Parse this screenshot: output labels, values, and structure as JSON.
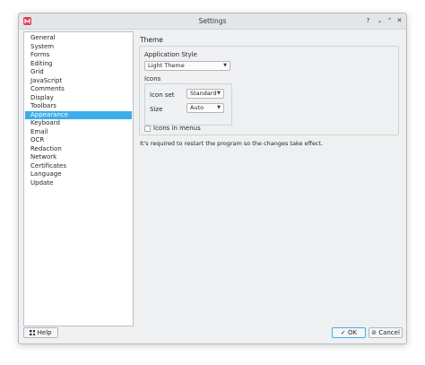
{
  "window": {
    "title": "Settings"
  },
  "titlebar": {
    "help": "?",
    "minimize": "⌄",
    "maximize": "⌃",
    "close": "✕"
  },
  "sidebar": {
    "items": [
      {
        "label": "General"
      },
      {
        "label": "System"
      },
      {
        "label": "Forms"
      },
      {
        "label": "Editing"
      },
      {
        "label": "Grid"
      },
      {
        "label": "JavaScript"
      },
      {
        "label": "Comments"
      },
      {
        "label": "Display"
      },
      {
        "label": "Toolbars"
      },
      {
        "label": "Appearance",
        "selected": true
      },
      {
        "label": "Keyboard"
      },
      {
        "label": "Email"
      },
      {
        "label": "OCR"
      },
      {
        "label": "Redaction"
      },
      {
        "label": "Network"
      },
      {
        "label": "Certificates"
      },
      {
        "label": "Language"
      },
      {
        "label": "Update"
      }
    ]
  },
  "theme": {
    "section_title": "Theme",
    "app_style_label": "Application Style",
    "app_style_value": "Light Theme",
    "icons_label": "Icons",
    "icon_set_label": "Icon set",
    "icon_set_value": "Standard",
    "size_label": "Size",
    "size_value": "Auto",
    "icons_in_menus_label": "Icons in menus",
    "icons_in_menus_checked": false
  },
  "note": "It's required to restart the program so the changes take effect.",
  "footer": {
    "help_label": "Help",
    "ok_label": "OK",
    "cancel_label": "Cancel"
  },
  "colors": {
    "selection": "#3daee9",
    "window_bg": "#eff0f1",
    "app_icon": "#da4453"
  },
  "icons": {
    "app": "app-logo-icon",
    "help_button": "grid-help-icon",
    "ok": "check-icon",
    "cancel": "cancel-icon"
  }
}
